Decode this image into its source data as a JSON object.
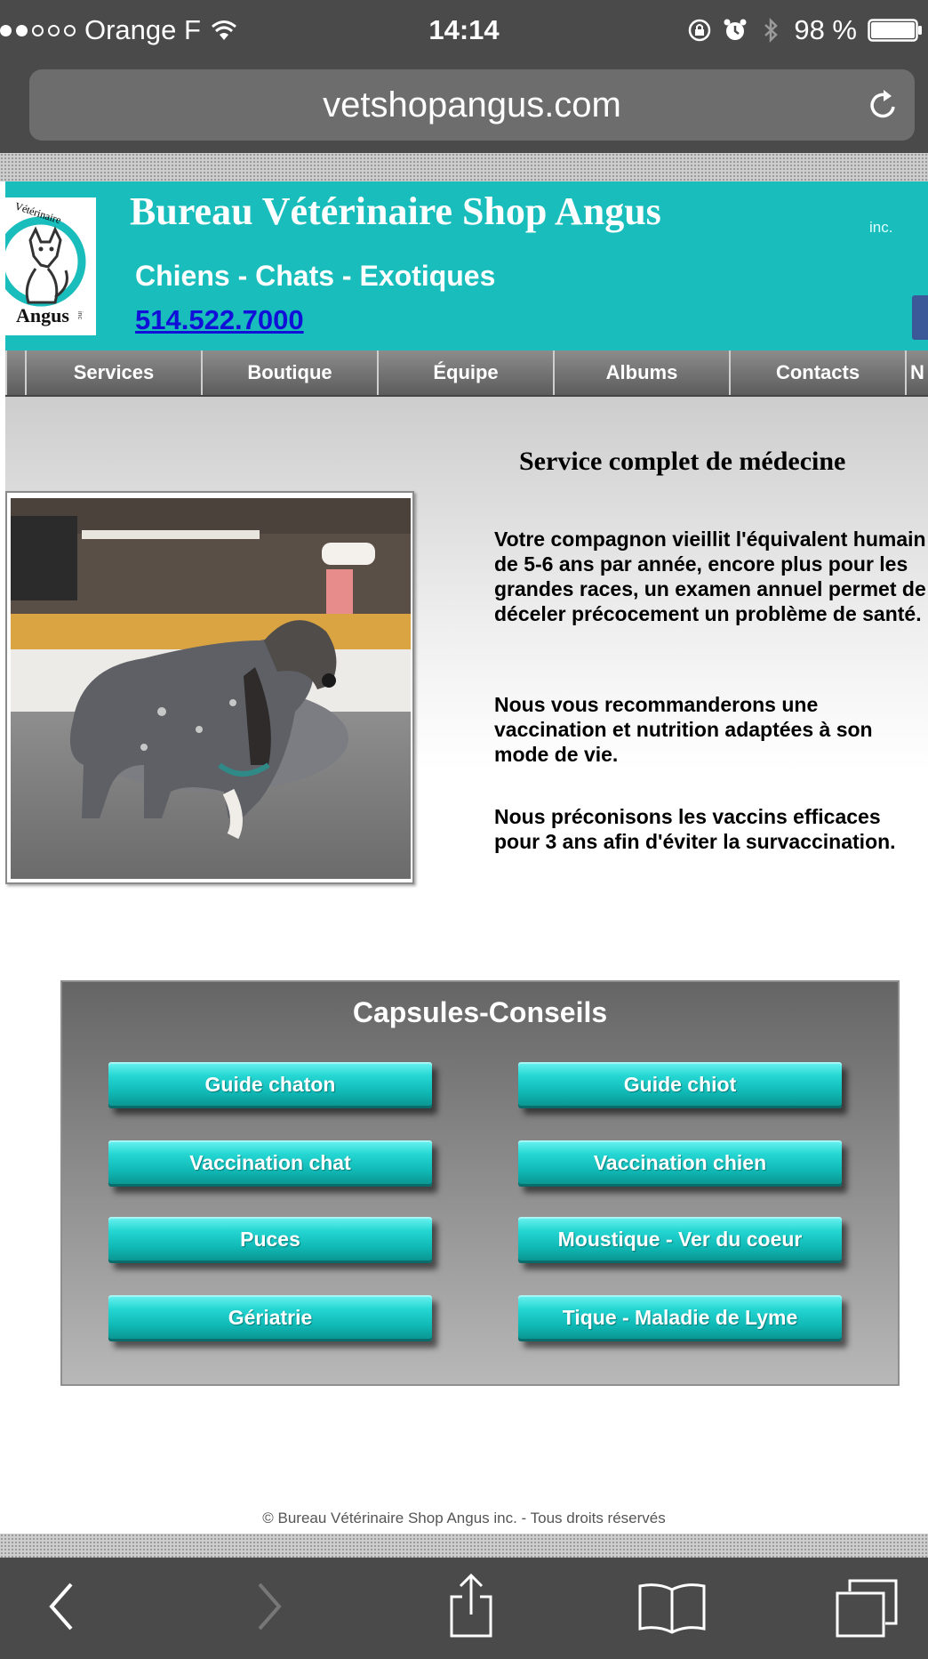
{
  "status_bar": {
    "carrier": "Orange F",
    "time": "14:14",
    "battery": "98 %",
    "signal_bars_filled": 2,
    "signal_bars_total": 5
  },
  "browser": {
    "url": "vetshopangus.com"
  },
  "site": {
    "title": "Bureau Vétérinaire Shop Angus",
    "inc_label": "inc.",
    "tagline": "Chiens - Chats - Exotiques",
    "phone": "514.522.7000",
    "logo": {
      "text_top": "Vétérinaire",
      "text_bottom": "Angus",
      "text_inc": "inc"
    },
    "nav": [
      "Services",
      "Boutique",
      "Équipe",
      "Albums",
      "Contacts",
      "N"
    ]
  },
  "content": {
    "title": "Service complet de médecine",
    "paragraphs": [
      "Votre compagnon vieillit l'équivalent humain de 5-6 ans par année, encore plus pour les grandes races, un examen annuel permet de déceler précocement un problème de santé.",
      "Nous vous recommanderons une vaccination et nutrition adaptées à son mode de vie.",
      "Nous préconisons les vaccins efficaces pour 3 ans afin d'éviter la survaccination."
    ]
  },
  "capsules": {
    "title": "Capsules-Conseils",
    "buttons": [
      "Guide chaton",
      "Guide chiot",
      "Vaccination chat",
      "Vaccination chien",
      "Puces",
      "Moustique - Ver du coeur",
      "Gériatrie",
      "Tique - Maladie de Lyme"
    ]
  },
  "footer": {
    "copyright": "© Bureau Vétérinaire Shop Angus inc. - Tous droits réservés"
  },
  "toolbar": {
    "icons": [
      "back-icon",
      "forward-icon",
      "share-icon",
      "bookmarks-icon",
      "tabs-icon"
    ]
  },
  "colors": {
    "banner": "#19bdbb",
    "button": "#10b9b6",
    "link": "#1010d8",
    "browser_chrome": "#4a4a4a"
  }
}
